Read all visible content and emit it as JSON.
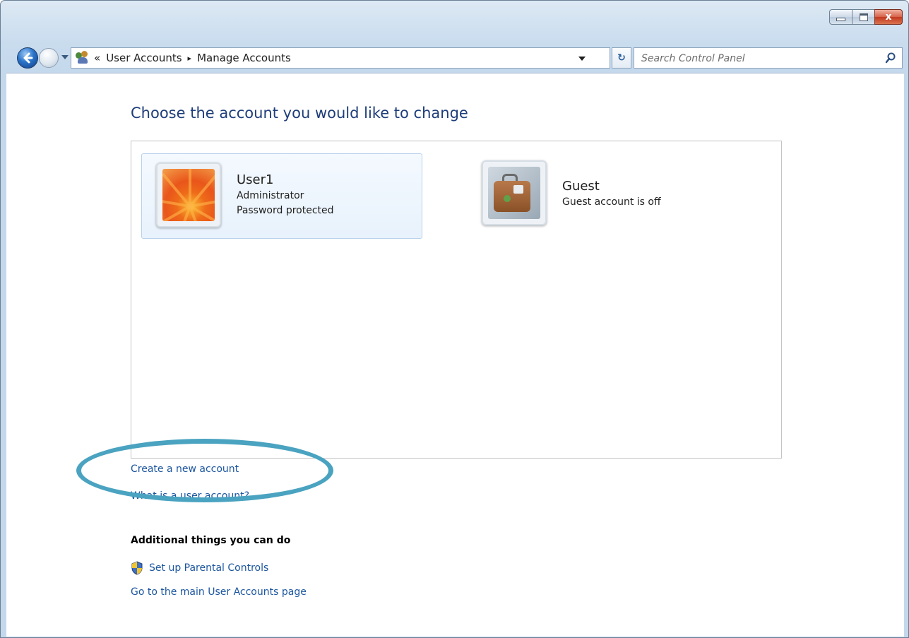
{
  "window": {
    "minimize_icon": "minimize-icon",
    "maximize_icon": "maximize-icon",
    "close_label": "x"
  },
  "navbar": {
    "breadcrumb_prefix": "«",
    "breadcrumbs": [
      "User Accounts",
      "Manage Accounts"
    ],
    "breadcrumb_separator": "▸",
    "refresh_label": "↻",
    "search_placeholder": "Search Control Panel"
  },
  "main": {
    "heading": "Choose the account you would like to change",
    "accounts": [
      {
        "name": "User1",
        "line1": "Administrator",
        "line2": "Password protected",
        "picture": "orange-flower",
        "selected": true
      },
      {
        "name": "Guest",
        "line1": "Guest account is off",
        "picture": "suitcase",
        "selected": false
      }
    ],
    "links": {
      "create": "Create a new account",
      "what_is": "What is a user account?"
    },
    "additional_heading": "Additional things you can do",
    "parental_controls": "Set up Parental Controls",
    "main_page": "Go to the main User Accounts page"
  },
  "colors": {
    "link": "#1c56a0",
    "heading": "#1e3d7a",
    "highlight": "#4aa3c0"
  }
}
